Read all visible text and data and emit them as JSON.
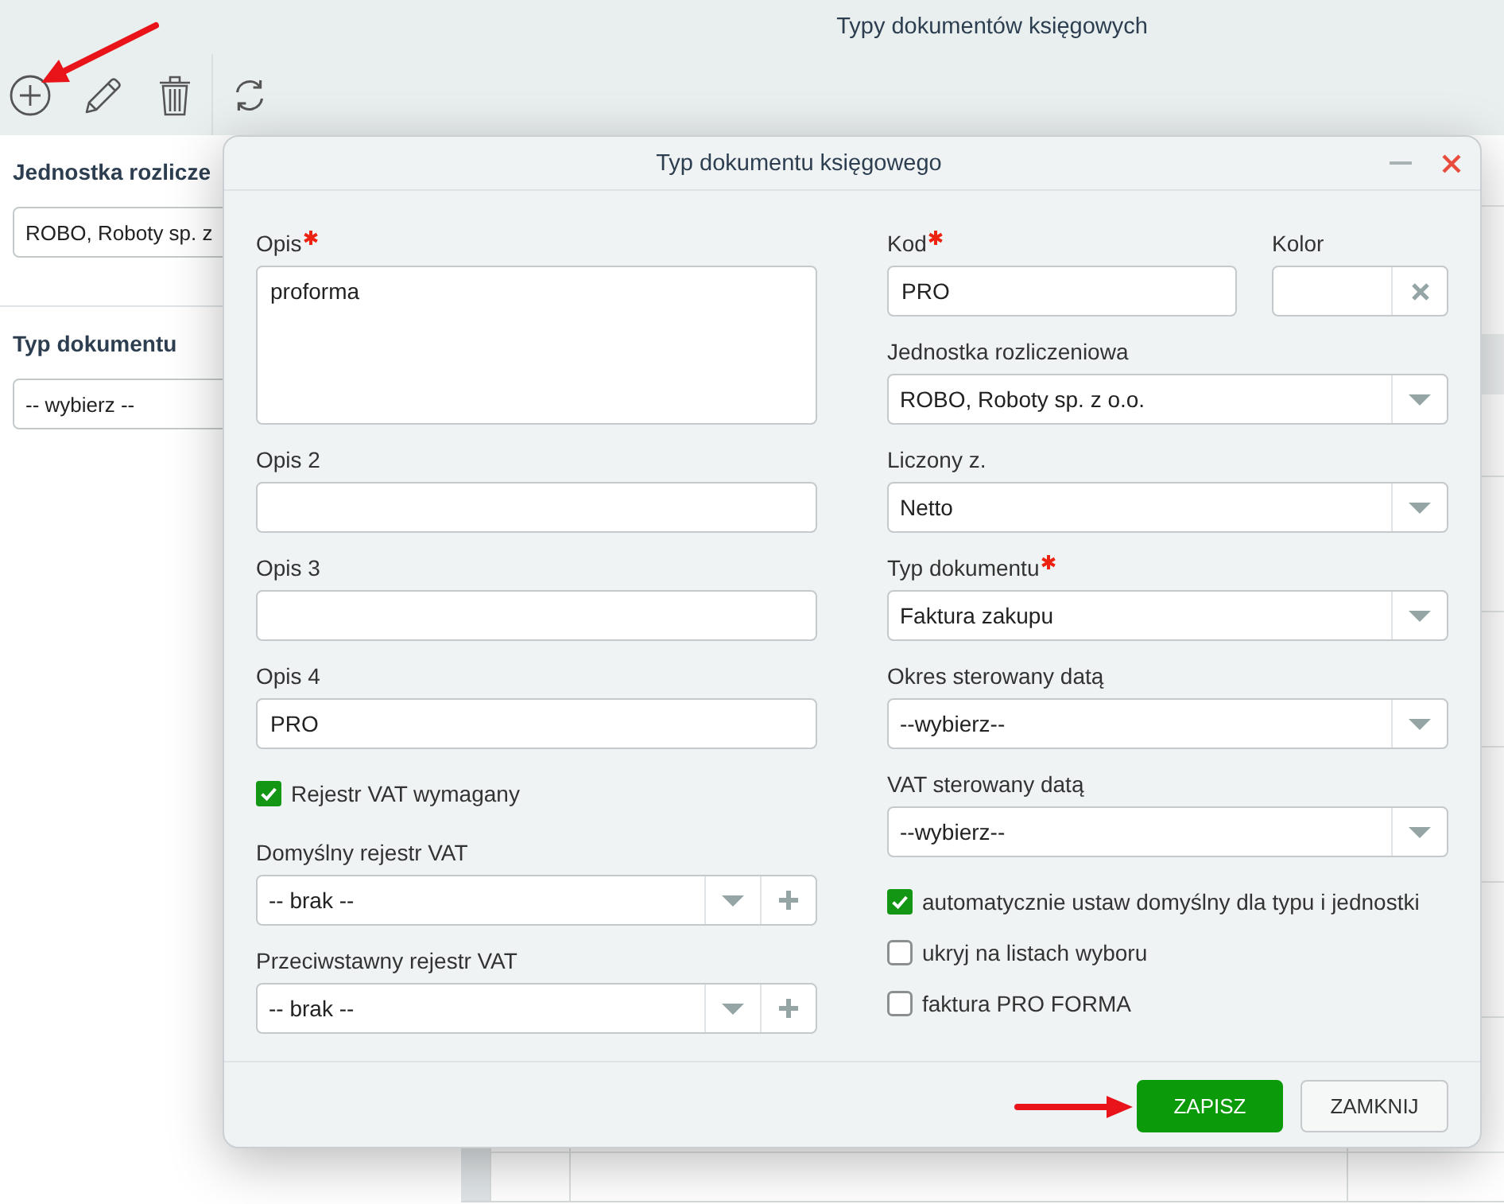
{
  "page": {
    "title": "Typy dokumentów księgowych"
  },
  "filters": [
    {
      "label": "Jednostka rozlicze",
      "value": "ROBO, Roboty sp. z"
    },
    {
      "label": "Typ dokumentu",
      "value": "-- wybierz --"
    }
  ],
  "dialog": {
    "title": "Typ dokumentu księgowego",
    "left_fields": [
      {
        "kind": "textarea",
        "label": "Opis",
        "required": true,
        "value": "proforma"
      },
      {
        "kind": "input",
        "label": "Opis 2",
        "required": false
      },
      {
        "kind": "input",
        "label": "Opis 3",
        "required": false
      },
      {
        "kind": "input",
        "label": "Opis 4",
        "required": false,
        "value": "PRO"
      },
      {
        "kind": "checkbox",
        "label": "Rejestr VAT wymagany",
        "checked": true
      },
      {
        "kind": "select_add",
        "label": "Domyślny rejestr VAT",
        "required": false,
        "value": "-- brak --"
      },
      {
        "kind": "select_add",
        "label": "Przeciwstawny rejestr VAT",
        "required": false,
        "value": "-- brak --"
      }
    ],
    "right_fields": [
      {
        "kind": "row",
        "fields": [
          {
            "kind": "input",
            "label": "Kod",
            "required": true,
            "value": "PRO"
          },
          {
            "kind": "color",
            "label": "Kolor",
            "required": false
          }
        ]
      },
      {
        "kind": "select",
        "label": "Jednostka rozliczeniowa",
        "required": false,
        "value": "ROBO, Roboty sp. z o.o."
      },
      {
        "kind": "select",
        "label": "Liczony z.",
        "required": false,
        "value": "Netto"
      },
      {
        "kind": "select",
        "label": "Typ dokumentu",
        "required": true,
        "value": "Faktura zakupu"
      },
      {
        "kind": "select",
        "label": "Okres sterowany datą",
        "required": false,
        "value": "--wybierz--"
      },
      {
        "kind": "select",
        "label": "VAT sterowany datą",
        "required": false,
        "value": "--wybierz--"
      },
      {
        "kind": "checkbox",
        "label": "automatycznie ustaw domyślny dla typu i jednostki",
        "checked": true
      },
      {
        "kind": "checkbox",
        "label": "ukryj na listach wyboru",
        "checked": false
      },
      {
        "kind": "checkbox",
        "label": "faktura PRO FORMA",
        "checked": false
      }
    ],
    "buttons": [
      {
        "kind": "primary",
        "label": "ZAPISZ"
      },
      {
        "kind": "secondary",
        "label": "ZAMKNIJ"
      }
    ]
  }
}
